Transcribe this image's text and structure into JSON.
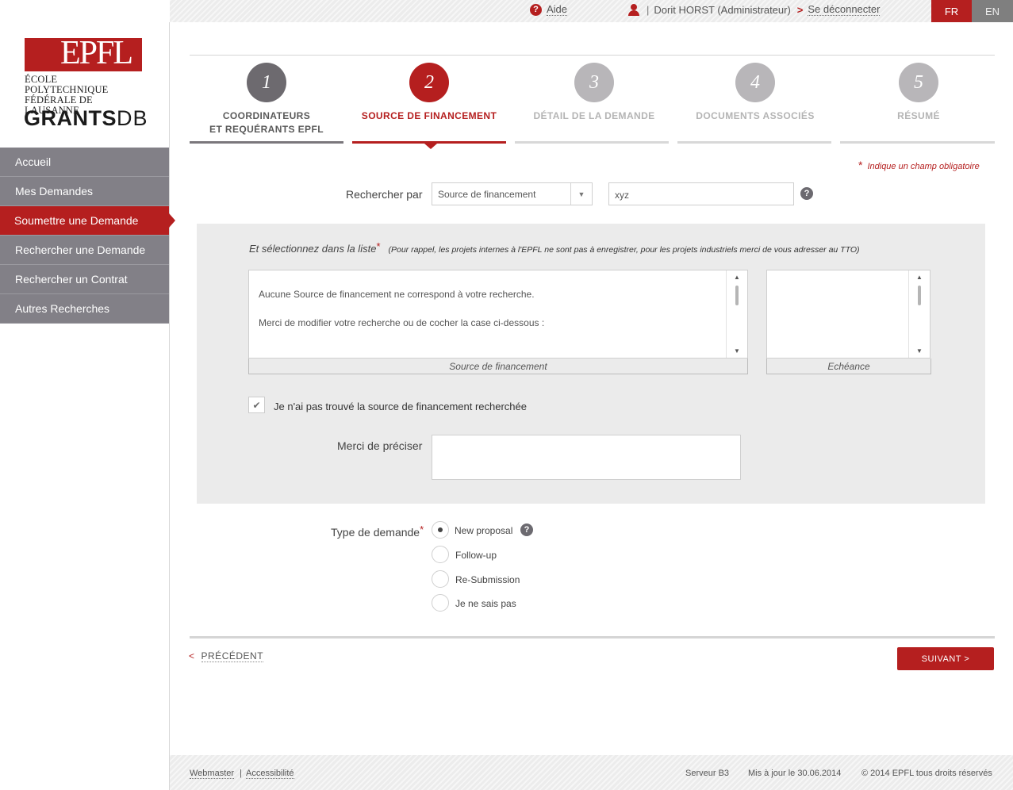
{
  "topbar": {
    "help_label": "Aide",
    "user_label": "Dorit HORST (Administrateur)",
    "user_sep": "|",
    "arrow": ">",
    "logout_label": "Se déconnecter",
    "lang_fr": "FR",
    "lang_en": "EN"
  },
  "logo": {
    "epfl_letters": "EPFL",
    "school_line1": "ÉCOLE POLYTECHNIQUE",
    "school_line2": "FÉDÉRALE DE LAUSANNE",
    "app_name_a": "GRANTS",
    "app_name_b": "DB"
  },
  "sidebar": {
    "items": [
      {
        "label": "Accueil"
      },
      {
        "label": "Mes Demandes"
      },
      {
        "label": "Soumettre une Demande"
      },
      {
        "label": "Rechercher une Demande"
      },
      {
        "label": "Rechercher un Contrat"
      },
      {
        "label": "Autres Recherches"
      }
    ],
    "active_index": 2
  },
  "steps": [
    {
      "num": "1",
      "line1": "COORDINATEURS",
      "line2": "ET REQUÉRANTS EPFL"
    },
    {
      "num": "2",
      "line1": "SOURCE DE FINANCEMENT",
      "line2": ""
    },
    {
      "num": "3",
      "line1": "DÉTAIL DE LA DEMANDE",
      "line2": ""
    },
    {
      "num": "4",
      "line1": "DOCUMENTS ASSOCIÉS",
      "line2": ""
    },
    {
      "num": "5",
      "line1": "RÉSUMÉ",
      "line2": ""
    }
  ],
  "required_note": "Indique un champ obligatoire",
  "required_star": "*",
  "search": {
    "label": "Rechercher par",
    "select_value": "Source de financement",
    "input_value": "xyz",
    "help": "?"
  },
  "panel": {
    "intro": "Et sélectionnez dans la liste",
    "intro_note": "(Pour rappel, les projets internes à l'EPFL ne sont pas à enregistrer, pour les projets industriels merci de vous adresser au TTO)",
    "list_msg1": "Aucune Source de financement ne correspond à votre recherche.",
    "list_msg2": "Merci de modifier votre recherche ou de cocher la case ci-dessous :",
    "caption_source": "Source de financement",
    "caption_echeance": "Echéance",
    "checkbox_label": "Je n'ai pas trouvé la source de financement recherchée",
    "checkbox_checked": true,
    "precise_label": "Merci de préciser",
    "precise_value": ""
  },
  "request_type": {
    "label": "Type de demande",
    "options": [
      "New proposal",
      "Follow-up",
      "Re-Submission",
      "Je ne sais pas"
    ],
    "selected": "New proposal"
  },
  "nav_buttons": {
    "prev_arrow": "<",
    "prev_label": "PRÉCÉDENT",
    "next_label": "SUIVANT >"
  },
  "footer": {
    "webmaster": "Webmaster",
    "sep": "|",
    "accessibility": "Accessibilité",
    "server": "Serveur B3",
    "updated": "Mis à jour le 30.06.2014",
    "copyright": "© 2014 EPFL tous droits réservés"
  },
  "colors": {
    "accent": "#b51f1f",
    "nav_bg": "#828087"
  }
}
